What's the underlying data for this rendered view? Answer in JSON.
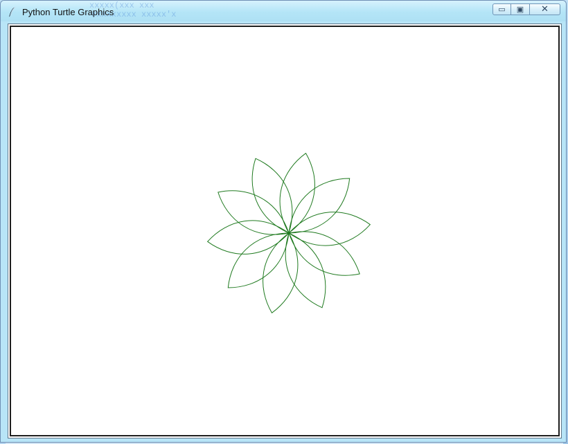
{
  "window": {
    "title": "Python Turtle Graphics",
    "icon": "feather-icon"
  },
  "background_text": {
    "line_1": "xxxxx(xxx   xxx",
    "line_2": "#xxxxxxxx xxxxx'x"
  },
  "controls": {
    "minimize_icon": "minimize-icon",
    "maximize_icon": "maximize-icon",
    "close_icon": "close-icon",
    "minimize_label": "▭",
    "maximize_label": "▣",
    "close_label": "✕"
  },
  "canvas": {
    "background_color": "#ffffff",
    "shape": "flower",
    "petal_count": 10,
    "petal_color": "#1f7a1f",
    "stroke_color": "#1f7a1f"
  }
}
